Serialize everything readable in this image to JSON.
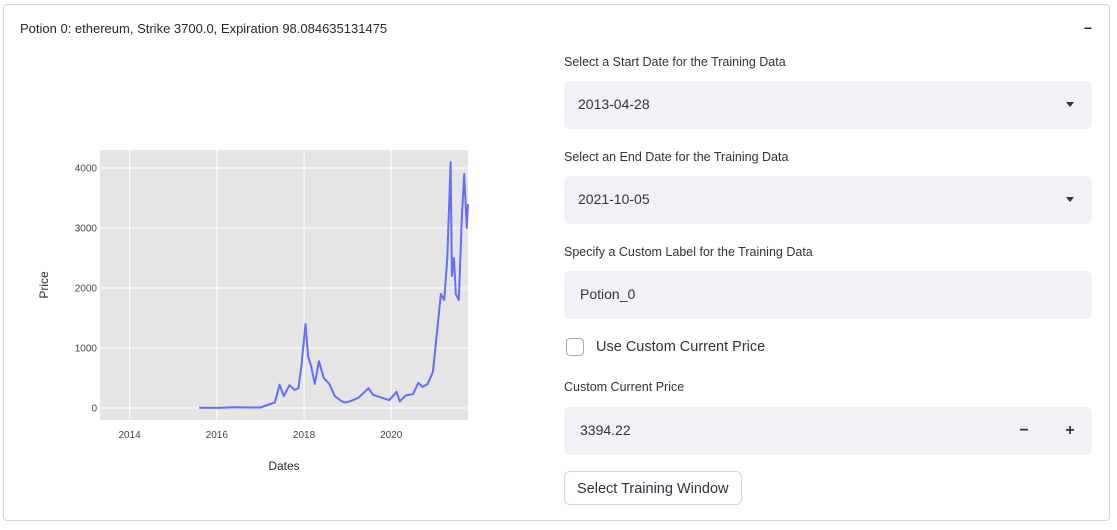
{
  "expander": {
    "title": "Potion 0: ethereum, Strike 3700.0, Expiration 98.084635131475",
    "collapse_symbol": "−"
  },
  "form": {
    "start_date_label": "Select a Start Date for the Training Data",
    "start_date_value": "2013-04-28",
    "end_date_label": "Select an End Date for the Training Data",
    "end_date_value": "2021-10-05",
    "custom_label_label": "Specify a Custom Label for the Training Data",
    "custom_label_value": "Potion_0",
    "use_custom_price_label": "Use Custom Current Price",
    "use_custom_price_checked": false,
    "custom_price_label": "Custom Current Price",
    "custom_price_value": "3394.22",
    "minus_symbol": "−",
    "plus_symbol": "+",
    "submit_label": "Select Training Window"
  },
  "chart_data": {
    "type": "line",
    "xlabel": "Dates",
    "ylabel": "Price",
    "xlim": [
      "2013-04-28",
      "2021-10-05"
    ],
    "ylim": [
      -200,
      4300
    ],
    "xticks": [
      "2014",
      "2016",
      "2018",
      "2020"
    ],
    "yticks": [
      0,
      1000,
      2000,
      3000,
      4000
    ],
    "grid": true,
    "line_color": "#636efa",
    "background": "#e5e5e5",
    "series": [
      {
        "x": [
          "2015-08-07",
          "2016-01-01",
          "2016-06-01",
          "2017-01-01",
          "2017-03-01",
          "2017-05-01",
          "2017-06-10",
          "2017-07-15",
          "2017-09-01",
          "2017-10-15",
          "2017-11-15",
          "2017-12-10",
          "2018-01-13",
          "2018-02-05",
          "2018-03-01",
          "2018-04-01",
          "2018-05-05",
          "2018-06-15",
          "2018-08-01",
          "2018-09-15",
          "2018-11-15",
          "2018-12-15",
          "2019-02-01",
          "2019-04-01",
          "2019-06-25",
          "2019-08-01",
          "2019-10-01",
          "2019-12-15",
          "2020-02-14",
          "2020-03-13",
          "2020-05-01",
          "2020-07-01",
          "2020-08-15",
          "2020-09-20",
          "2020-11-01",
          "2020-12-15",
          "2021-01-15",
          "2021-02-20",
          "2021-03-20",
          "2021-04-15",
          "2021-05-12",
          "2021-05-23",
          "2021-06-10",
          "2021-06-25",
          "2021-07-20",
          "2021-08-15",
          "2021-09-03",
          "2021-09-25",
          "2021-10-05"
        ],
        "y": [
          2.8,
          1,
          12,
          8,
          50,
          90,
          390,
          200,
          380,
          300,
          330,
          700,
          1400,
          850,
          700,
          400,
          780,
          500,
          400,
          200,
          110,
          90,
          120,
          170,
          330,
          220,
          180,
          130,
          270,
          110,
          210,
          230,
          420,
          350,
          400,
          600,
          1200,
          1900,
          1800,
          2500,
          4100,
          2200,
          2500,
          1900,
          1800,
          3200,
          3900,
          3000,
          3400
        ]
      }
    ]
  }
}
